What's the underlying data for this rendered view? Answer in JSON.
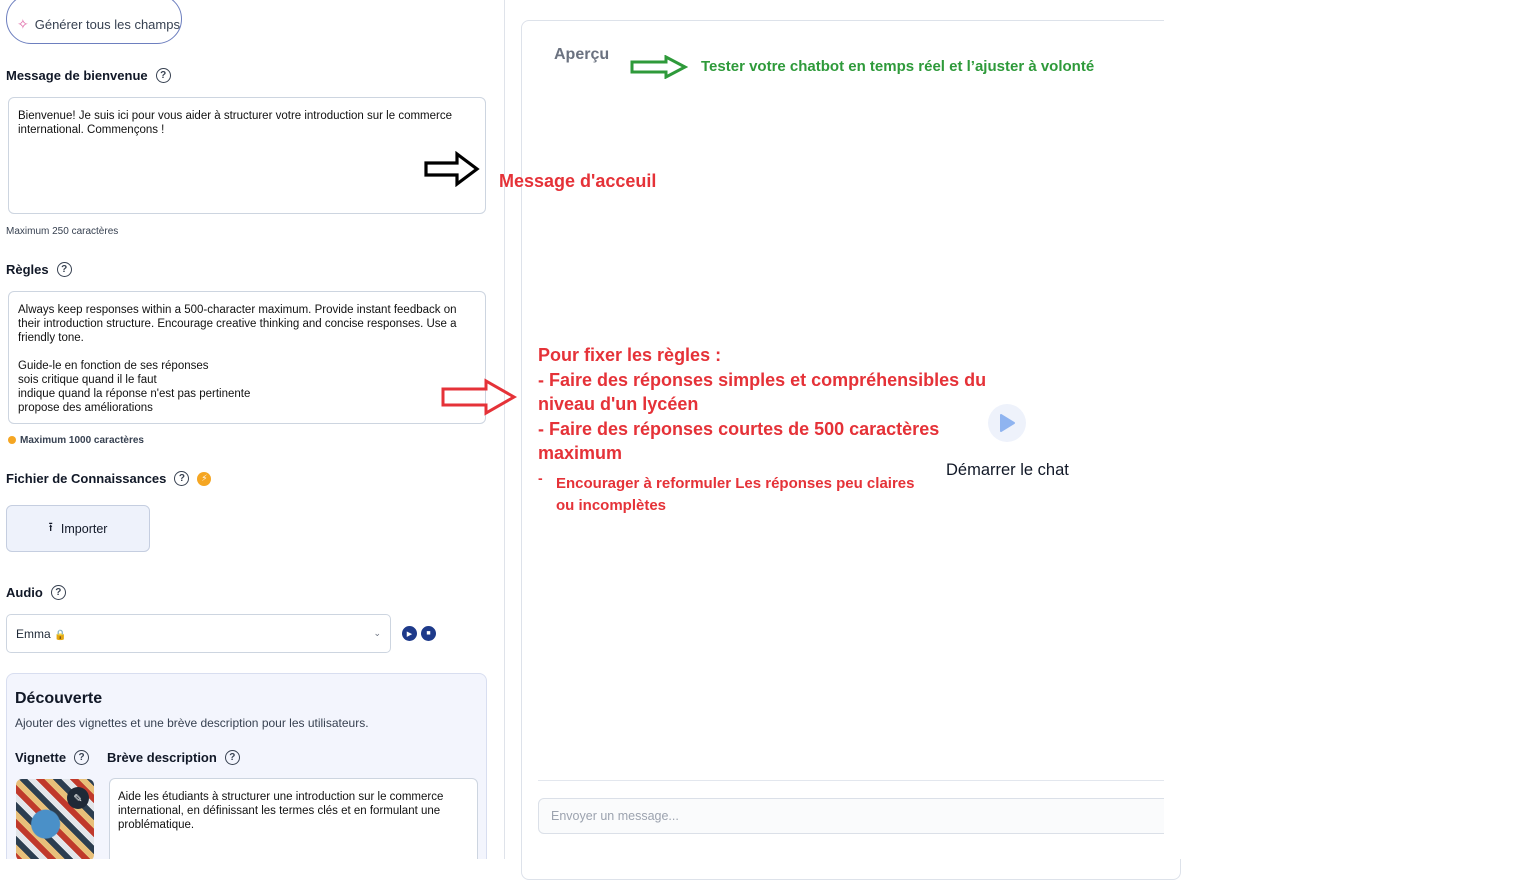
{
  "generate_button": {
    "label": "Générer tous les champs",
    "icon": "sparkle-icon"
  },
  "welcome": {
    "label": "Message de bienvenue",
    "text": "Bienvenue! Je suis ici pour vous aider à structurer votre introduction sur le commerce international. Commençons !",
    "hint": "Maximum 250 caractères"
  },
  "rules": {
    "label": "Règles",
    "text": "Always keep responses within a 500-character maximum. Provide instant feedback on their introduction structure. Encourage creative thinking and concise responses. Use a friendly  tone.\n\nGuide-le en fonction de ses réponses\n sois critique quand il le faut\nindique quand la réponse n'est pas pertinente\npropose des améliorations",
    "hint": "Maximum 1000 caractères"
  },
  "knowledge": {
    "label": "Fichier de Connaissances",
    "import_label": "Importer"
  },
  "audio": {
    "label": "Audio",
    "voice": "Emma",
    "voice_emoji": "🔒"
  },
  "discover": {
    "title": "Découverte",
    "subtitle": "Ajouter des vignettes et une brève description pour les utilisateurs.",
    "thumbnail_label": "Vignette",
    "description_label": "Brève description",
    "description": "Aide les étudiants à structurer une introduction sur le commerce international, en définissant les termes clés et en formulant une problématique."
  },
  "preview": {
    "title": "Aperçu",
    "start_chat": "Démarrer le chat",
    "input_placeholder": "Envoyer un message..."
  },
  "annotations": {
    "preview_note": "Tester votre chatbot en temps réel et l’ajuster à volonté",
    "welcome_note": "Message d'acceuil",
    "rules_title": "Pour fixer les règles :",
    "rules_line1": "- Faire des réponses simples et compréhensibles du",
    "rules_line2": "niveau d'un lycéen",
    "rules_line3": "- Faire des réponses courtes de 500 caractères",
    "rules_line4": "maximum",
    "rules_line5_dash": "-",
    "rules_line5": "Encourager à reformuler Les réponses peu claires",
    "rules_line6": "ou incomplètes",
    "colors": {
      "green": "#2e9a3a",
      "red": "#e53238",
      "black": "#000000"
    }
  }
}
